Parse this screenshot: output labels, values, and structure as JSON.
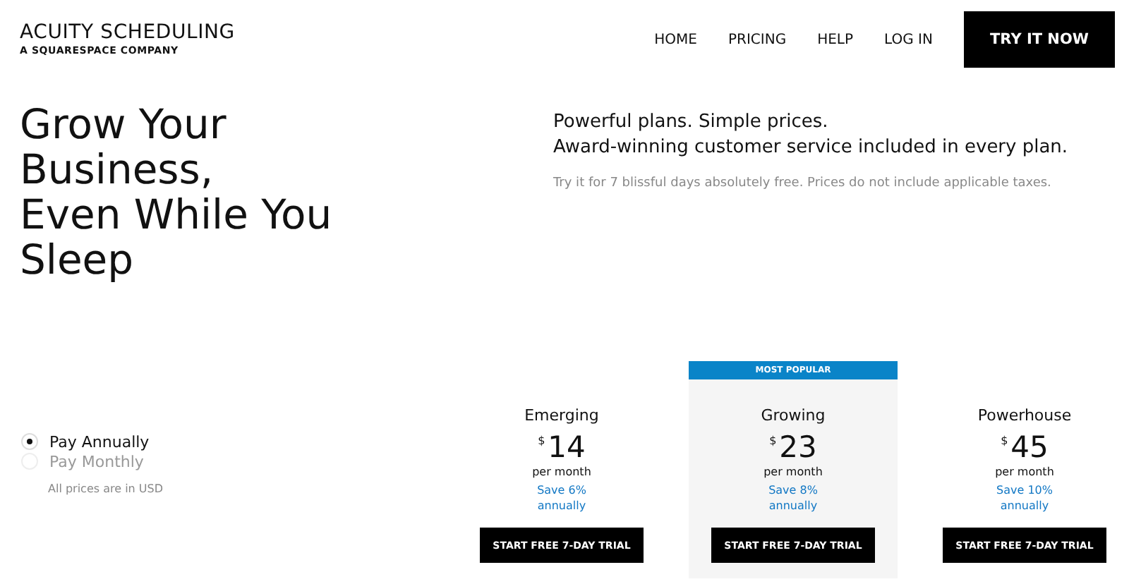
{
  "logo": {
    "name": "ACUITY SCHEDULING",
    "tagline": "A SQUARESPACE COMPANY"
  },
  "nav": {
    "links": [
      "HOME",
      "PRICING",
      "HELP",
      "LOG IN"
    ],
    "cta": "TRY IT NOW"
  },
  "hero": {
    "title_lines": [
      "Grow Your",
      "Business,",
      "Even While You",
      "Sleep"
    ]
  },
  "intro": {
    "headline_lines": [
      "Powerful plans. Simple prices.",
      "Award-winning customer service included in every plan."
    ],
    "note": "Try it for 7 blissful days absolutely free. Prices do not include applicable taxes."
  },
  "billing": {
    "options": [
      {
        "label": "Pay Annually",
        "selected": true
      },
      {
        "label": "Pay Monthly",
        "selected": false
      }
    ],
    "currency_note": "All prices are in USD"
  },
  "plans": [
    {
      "name": "Emerging",
      "currency": "$",
      "price": "14",
      "period": "per month",
      "savings": "Save 6%\nannually",
      "button": "START FREE 7-DAY TRIAL"
    },
    {
      "name": "Growing",
      "currency": "$",
      "price": "23",
      "period": "per month",
      "savings": "Save 8%\nannually",
      "button": "START FREE 7-DAY TRIAL",
      "badge": "MOST POPULAR"
    },
    {
      "name": "Powerhouse",
      "currency": "$",
      "price": "45",
      "period": "per month",
      "savings": "Save 10%\nannually",
      "button": "START FREE 7-DAY TRIAL"
    }
  ]
}
